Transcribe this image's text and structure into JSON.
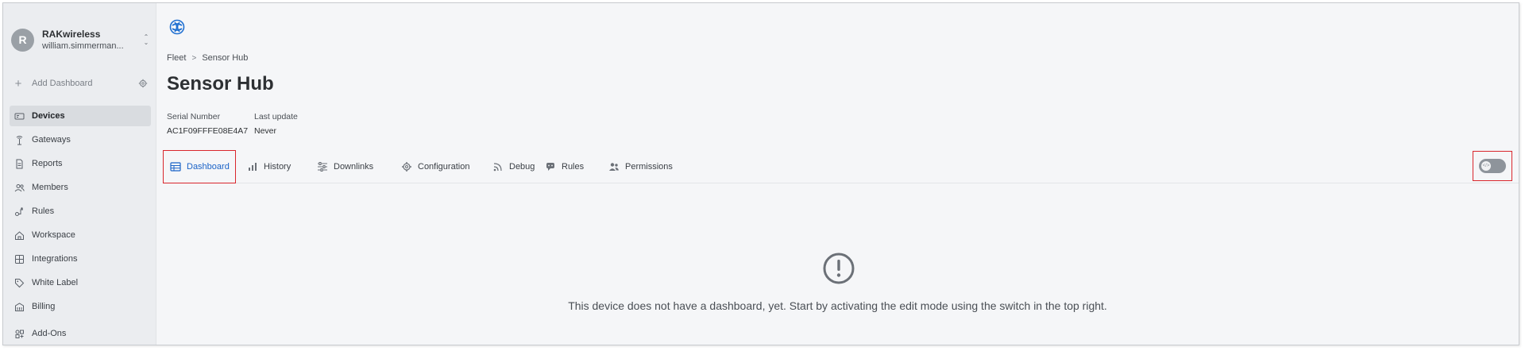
{
  "sidebar": {
    "org_initial": "R",
    "org_name": "RAKwireless",
    "org_user": "william.simmerman...",
    "add_dashboard": "Add Dashboard",
    "items": [
      {
        "label": "Devices",
        "icon": "devices-icon",
        "active": true
      },
      {
        "label": "Gateways",
        "icon": "gateway-icon"
      },
      {
        "label": "Reports",
        "icon": "report-icon"
      },
      {
        "label": "Members",
        "icon": "members-icon"
      },
      {
        "label": "Rules",
        "icon": "rules-icon"
      },
      {
        "label": "Workspace",
        "icon": "workspace-icon"
      },
      {
        "label": "Integrations",
        "icon": "integrations-icon"
      },
      {
        "label": "White Label",
        "icon": "tag-icon"
      },
      {
        "label": "Billing",
        "icon": "billing-icon"
      },
      {
        "label": "Add-Ons",
        "icon": "addons-icon"
      }
    ]
  },
  "breadcrumb": {
    "root": "Fleet",
    "current": "Sensor Hub"
  },
  "title": "Sensor Hub",
  "meta": {
    "serial_label": "Serial Number",
    "serial_value": "AC1F09FFFE08E4A7",
    "update_label": "Last update",
    "update_value": "Never"
  },
  "tabs": [
    {
      "label": "Dashboard",
      "icon": "dashboard-icon",
      "active": true
    },
    {
      "label": "History",
      "icon": "bar-chart-icon"
    },
    {
      "label": "Downlinks",
      "icon": "sliders-icon"
    },
    {
      "label": "Configuration",
      "icon": "gear-icon"
    },
    {
      "label": "Debug",
      "icon": "rss-icon"
    },
    {
      "label": "Rules",
      "icon": "rules-icon"
    },
    {
      "label": "Permissions",
      "icon": "people-icon"
    }
  ],
  "edit_toggle": {
    "knob_symbol": "</>",
    "on": false
  },
  "empty_state": {
    "message": "This device does not have a dashboard, yet. Start by activating the edit mode using the switch in the top right.",
    "icon": "exclamation-circle-icon"
  },
  "colors": {
    "accent": "#1b63c7",
    "highlight": "#d9262c",
    "sidebar_bg": "#ebedf0"
  }
}
